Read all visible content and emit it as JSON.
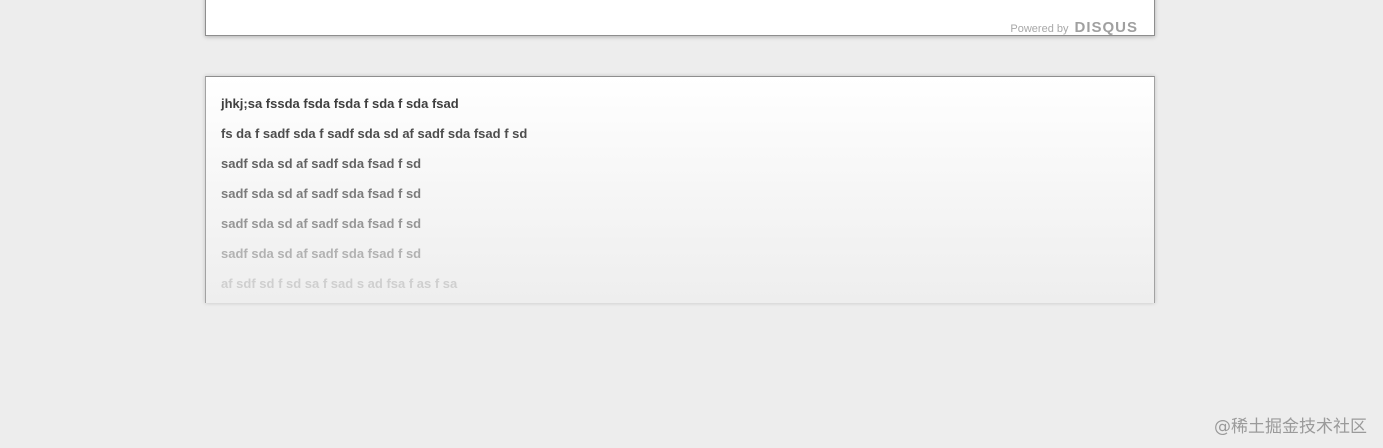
{
  "footer": {
    "powered_by": "Powered by",
    "brand": "DISQUS"
  },
  "content": {
    "lines": [
      "jhkj;sa fssda fsda fsda f sda f sda fsad",
      "fs da f sadf sda f sadf sda sd af sadf sda fsad f sd",
      "sadf sda sd af sadf sda fsad f sd",
      "sadf sda sd af sadf sda fsad f sd",
      "sadf sda sd af sadf sda fsad f sd",
      "sadf sda sd af sadf sda fsad f sd",
      "af sdf sd f sd sa f sad s ad fsa f as f sa"
    ]
  },
  "watermark": "@稀土掘金技术社区"
}
